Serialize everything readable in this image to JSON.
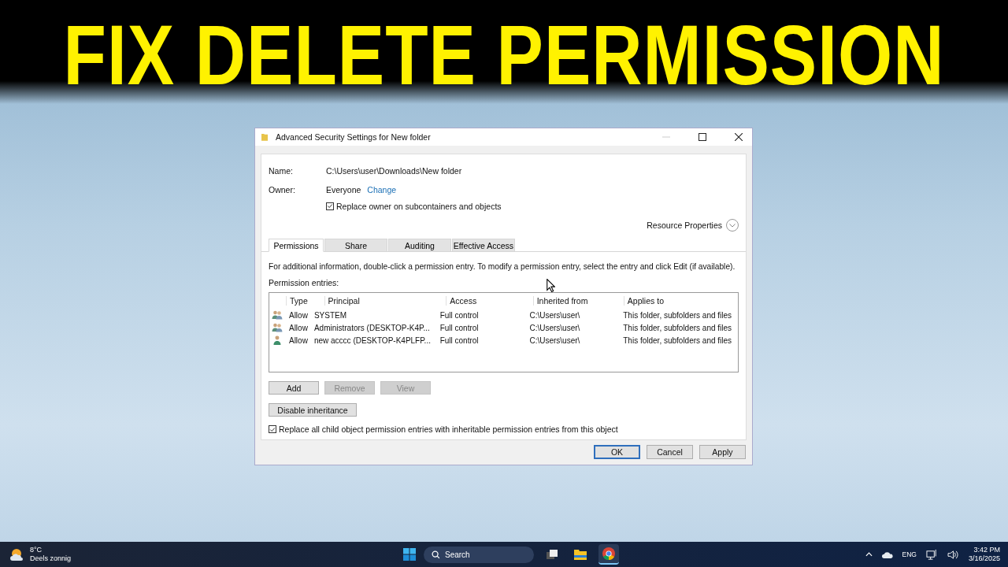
{
  "banner": {
    "title": "FIX DELETE PERMISSION"
  },
  "window": {
    "title": "Advanced Security Settings for New folder",
    "name_label": "Name:",
    "name_value": "C:\\Users\\user\\Downloads\\New folder",
    "owner_label": "Owner:",
    "owner_value": "Everyone",
    "owner_link": "Change",
    "replace_owner": {
      "label": "Replace owner on subcontainers and objects",
      "checked": true
    },
    "resource_properties": "Resource Properties",
    "tabs": [
      {
        "label": "Permissions",
        "selected": true
      },
      {
        "label": "Share",
        "selected": false
      },
      {
        "label": "Auditing",
        "selected": false
      },
      {
        "label": "Effective Access",
        "selected": false
      }
    ],
    "info": "For additional information, double-click a permission entry. To modify a permission entry, select the entry and click Edit (if available).",
    "entries_label": "Permission entries:",
    "columns": [
      "Type",
      "Principal",
      "Access",
      "Inherited from",
      "Applies to"
    ],
    "rows": [
      {
        "kind": "group",
        "cells": [
          "Allow",
          "SYSTEM",
          "Full control",
          "C:\\Users\\user\\",
          "This folder, subfolders and files"
        ]
      },
      {
        "kind": "group",
        "cells": [
          "Allow",
          "Administrators (DESKTOP-K4P...",
          "Full control",
          "C:\\Users\\user\\",
          "This folder, subfolders and files"
        ]
      },
      {
        "kind": "user",
        "cells": [
          "Allow",
          "new acccc (DESKTOP-K4PLFP...",
          "Full control",
          "C:\\Users\\user\\",
          "This folder, subfolders and files"
        ]
      }
    ],
    "entry_buttons": [
      {
        "label": "Add",
        "disabled": false
      },
      {
        "label": "Remove",
        "disabled": true
      },
      {
        "label": "View",
        "disabled": true
      }
    ],
    "inheritance_button": "Disable inheritance",
    "replace_children": {
      "label": "Replace all child object permission entries with inheritable permission entries from this object",
      "checked": true
    },
    "footer_buttons": [
      {
        "label": "OK",
        "selected": true
      },
      {
        "label": "Cancel",
        "selected": false
      },
      {
        "label": "Apply",
        "selected": false
      }
    ]
  },
  "taskbar": {
    "weather_temp": "8°C",
    "weather_text": "Deels zonnig",
    "search_placeholder": "Search",
    "apps": [
      {
        "kind": "taskview",
        "selected": false
      },
      {
        "kind": "explorer",
        "selected": false
      },
      {
        "kind": "chrome",
        "selected": true
      }
    ],
    "language": "ENG",
    "time": "3:42 PM",
    "date": "3/16/2025"
  }
}
